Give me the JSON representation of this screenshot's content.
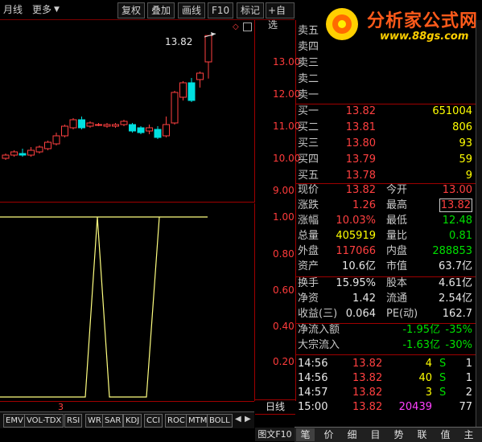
{
  "toolbar": {
    "period": "月线",
    "more": "更多",
    "fuquan": "复权",
    "overlay": "叠加",
    "drawline": "画线",
    "f10": "F10",
    "mark": "标记",
    "add_watch": "+自选"
  },
  "logo": {
    "title": "分析家公式网",
    "url": "www.88gs.com"
  },
  "kchart": {
    "high_marker": "13.82",
    "axis": [
      "13.00",
      "12.00",
      "11.00",
      "10.00",
      "9.00"
    ]
  },
  "indicator": {
    "axis": [
      "1.00",
      "0.80",
      "0.60",
      "0.40",
      "0.20"
    ],
    "marker": "3"
  },
  "period_label": "日线",
  "tuwen": "图文F10",
  "tabs": [
    "EMV",
    "VOL-TDX",
    "RSI",
    "WR",
    "SAR",
    "KDJ",
    "CCI",
    "ROC",
    "MTM",
    "BOLL"
  ],
  "sell": [
    {
      "label": "卖五",
      "price": "",
      "vol": ""
    },
    {
      "label": "卖四",
      "price": "",
      "vol": ""
    },
    {
      "label": "卖三",
      "price": "",
      "vol": ""
    },
    {
      "label": "卖二",
      "price": "",
      "vol": ""
    },
    {
      "label": "卖一",
      "price": "",
      "vol": ""
    }
  ],
  "buy": [
    {
      "label": "买一",
      "price": "13.82",
      "vol": "651004"
    },
    {
      "label": "买二",
      "price": "13.81",
      "vol": "806"
    },
    {
      "label": "买三",
      "price": "13.80",
      "vol": "93"
    },
    {
      "label": "买四",
      "price": "13.79",
      "vol": "59"
    },
    {
      "label": "买五",
      "price": "13.78",
      "vol": "9"
    }
  ],
  "stats": [
    {
      "l1": "现价",
      "v1": "13.82",
      "l2": "今开",
      "v2": "13.00"
    },
    {
      "l1": "涨跌",
      "v1": "1.26",
      "l2": "最高",
      "v2": "13.82"
    },
    {
      "l1": "涨幅",
      "v1": "10.03%",
      "l2": "最低",
      "v2": "12.48"
    },
    {
      "l1": "总量",
      "v1": "405919",
      "l2": "量比",
      "v2": "0.81"
    },
    {
      "l1": "外盘",
      "v1": "117066",
      "l2": "内盘",
      "v2": "288853"
    },
    {
      "l1": "资产",
      "v1": "10.6亿",
      "l2": "市值",
      "v2": "63.7亿"
    }
  ],
  "fin": [
    {
      "l1": "换手",
      "v1": "15.95%",
      "l2": "股本",
      "v2": "4.61亿"
    },
    {
      "l1": "净资",
      "v1": "1.42",
      "l2": "流通",
      "v2": "2.54亿"
    },
    {
      "l1": "收益(三)",
      "v1": "0.064",
      "l2": "PE(动)",
      "v2": "162.7"
    }
  ],
  "flow": [
    {
      "label": "净流入额",
      "amount": "-1.95亿",
      "pct": "-35%"
    },
    {
      "label": "大宗流入",
      "amount": "-1.63亿",
      "pct": "-30%"
    }
  ],
  "ticks": [
    {
      "time": "14:56",
      "price": "13.82",
      "vol": "4",
      "side": "S",
      "num": "1"
    },
    {
      "time": "14:56",
      "price": "13.82",
      "vol": "40",
      "side": "S",
      "num": "1"
    },
    {
      "time": "14:57",
      "price": "13.82",
      "vol": "3",
      "side": "S",
      "num": "2"
    },
    {
      "time": "15:00",
      "price": "13.82",
      "vol": "20439",
      "side": "",
      "num": "77"
    }
  ],
  "sidetabs": [
    "笔",
    "价",
    "细",
    "目",
    "势",
    "联",
    "值",
    "主"
  ],
  "colors": {
    "up": "#ff4040",
    "down": "#00e0e0",
    "axis": "#a00000",
    "indicator": "#ffff80"
  }
}
